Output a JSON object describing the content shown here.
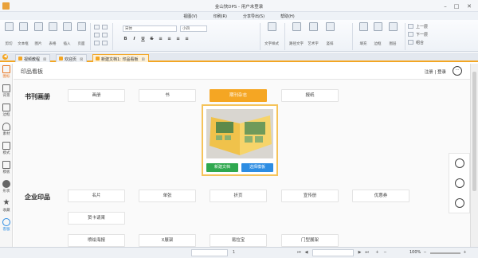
{
  "window": {
    "title": "金山快DPS - 用户未登录"
  },
  "menu": [
    "视图(V)",
    "印刷(R)",
    "分享导出(S)",
    "帮助(H)"
  ],
  "ribbon": {
    "left_buttons": [
      "剪切",
      "文本框",
      "图片",
      "表格",
      "插入",
      "页面"
    ],
    "font_name": "宋体",
    "font_size": "小四",
    "format": [
      "B",
      "I",
      "U",
      "S"
    ],
    "right_buttons": [
      "文字样式",
      "路径文字",
      "艺术字",
      "竖排",
      "填充",
      "边框",
      "图层"
    ],
    "arrange": [
      "上一层",
      "下一层",
      "组合"
    ]
  },
  "tabs": [
    {
      "label": "视频教程",
      "close": "⊠"
    },
    {
      "label": "欢迎页",
      "close": "⊠"
    },
    {
      "label": "新建文档1: 印品看板",
      "close": "⊠"
    }
  ],
  "leftbar": [
    "图标",
    "背景",
    "边框",
    "素材",
    "模式",
    "模板",
    "形状",
    "收藏",
    "客服"
  ],
  "board": {
    "title": "印品看板",
    "register": "注册",
    "divider": "|",
    "login": "登录",
    "chat_icon": "···"
  },
  "section1": {
    "title": "书刊画册",
    "items": [
      "画册",
      "书",
      "期刊杂志",
      "报纸"
    ],
    "active": "期刊杂志"
  },
  "popup": {
    "new_doc": "新建文档",
    "choose_template": "选择模板"
  },
  "section2": {
    "title": "企业印品",
    "row1": [
      "名片",
      "单张",
      "折页",
      "宣传册",
      "优惠券"
    ],
    "row2": [
      "贺卡请柬"
    ],
    "row3": [
      "喷绘海报",
      "X展架",
      "易拉宝",
      "门型展架"
    ]
  },
  "statusbar": {
    "zoom": "100%",
    "page": "1"
  },
  "colors": {
    "accent": "#f5a623",
    "new_doc": "#2fa84f",
    "choose_template": "#2d8de3"
  }
}
